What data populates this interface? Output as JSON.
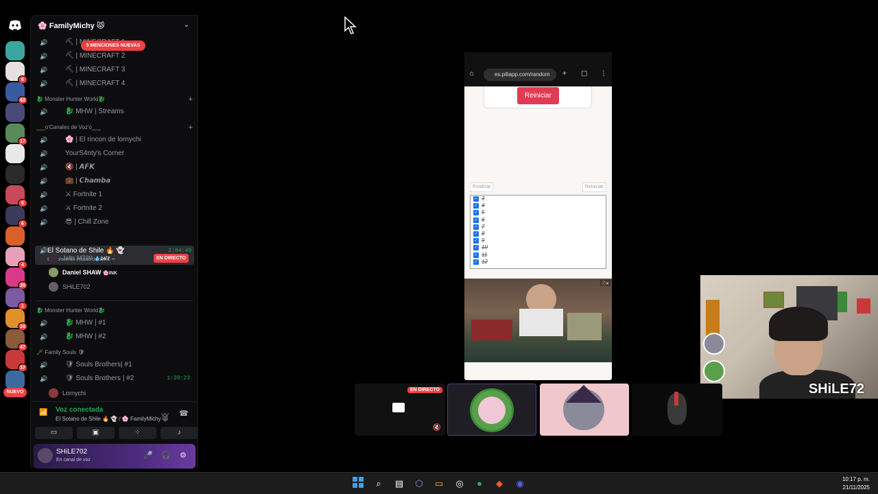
{
  "server": {
    "name": "🌸 FamilyMichy 😾",
    "mentions_label": "5 MENCIONES NUEVAS"
  },
  "rail": {
    "badges": [
      "6",
      "62",
      "",
      "17",
      "",
      "",
      "6",
      "6",
      "",
      "4",
      "20",
      "1",
      "20",
      "47",
      "37",
      "",
      ""
    ],
    "new_label": "NUEVO"
  },
  "channels": [
    {
      "name": "⛏ | MINECRAFT 1",
      "icon": ""
    },
    {
      "name": "⛏ | MINECRAFT 2",
      "icon": ""
    },
    {
      "name": "⛏ | MINECRAFT 3",
      "icon": ""
    },
    {
      "name": "⛏ | MINECRAFT 4",
      "icon": ""
    }
  ],
  "categories": {
    "mhw": "🐉 Monster Hunter World🐉",
    "voz": "‿‿o'Canales de Voz'o‿‿",
    "mhw2": "🐉 Monster Hunter World🐉",
    "souls": "🗡 Family Souls 🛡"
  },
  "channels_mhw": [
    {
      "name": "🐉 MHW | Streams"
    }
  ],
  "channels_voz": [
    {
      "name": "🌸 | El rincon de lornychi"
    },
    {
      "name": "YourS4nty's Corner"
    },
    {
      "name": "🔇 | 𝘼𝙁𝙆"
    },
    {
      "name": "💼 | 𝘾𝙝𝙖𝙢𝙗𝙖"
    },
    {
      "name": "⚔ Fortnite 1"
    },
    {
      "name": "⚔ Fortnite 2"
    },
    {
      "name": "😎 | Chill Zone"
    }
  ],
  "active_channel": {
    "name": "El Sotano de Shile 🔥 👻",
    "status": "Establece un estado de canal ✏",
    "time": "2:04:49"
  },
  "users_in_voice": [
    {
      "name": "Jalts MT09",
      "tag": "💧24/7",
      "live": "EN DIRECTO"
    },
    {
      "name": "Daniel SHAW",
      "tag": "🌸INK",
      "live": ""
    },
    {
      "name": "SHiLE702",
      "tag": "",
      "live": ""
    }
  ],
  "channels_mhw2": [
    {
      "name": "🐉 MHW | #1"
    },
    {
      "name": "🐉 MHW | #2"
    }
  ],
  "channels_souls": [
    {
      "name": "🛡 Souls Brothers| #1",
      "time": ""
    },
    {
      "name": "🛡 Souls Brothers | #2",
      "time": "1:20:23"
    }
  ],
  "souls_user": "Lornychi",
  "voice": {
    "connected": "Voz conectada",
    "location": "El Sotano de Shile 🔥 👻 / 🌸 FamilyMichy 😾"
  },
  "userbar": {
    "name": "SHiLE702",
    "status": "En canal de voz"
  },
  "stream": {
    "url": "es.piliapp.com/random",
    "reiniciar": "Reiniciar",
    "finalizar_small": "Finalizar",
    "reiniciar_small": "Reiniciar",
    "items": [
      "3",
      "4",
      "5",
      "6",
      "7",
      "8",
      "9",
      "10",
      "11",
      "12"
    ]
  },
  "webcam": {
    "label": "SHiLE72"
  },
  "tiles": {
    "live": "EN DIRECTO"
  },
  "taskbar": {
    "time": "10:17 p. m.",
    "date": "21/11/2025"
  },
  "colors": {
    "accent_red": "#f23f43",
    "green": "#23a55a",
    "reiniciar": "#e23a54"
  }
}
